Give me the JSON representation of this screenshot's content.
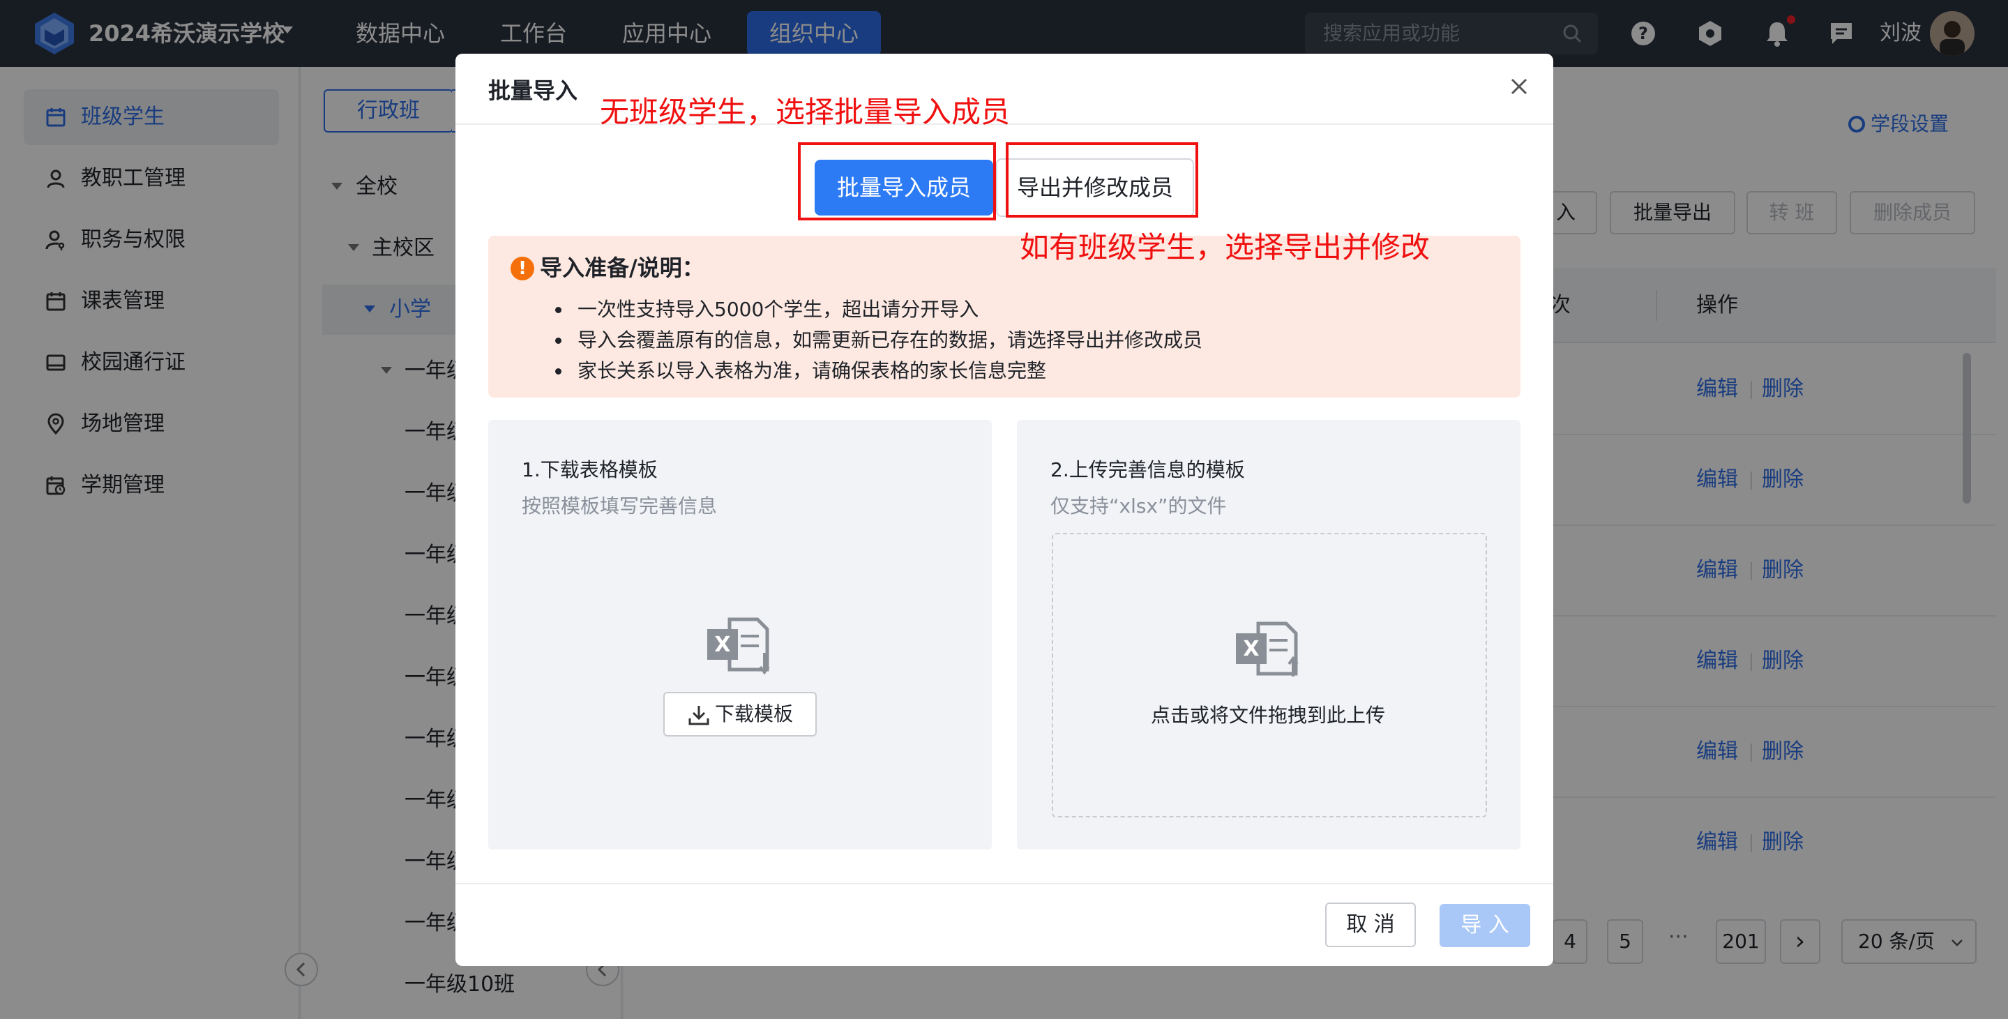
{
  "topbar": {
    "school_name": "2024希沃演示学校",
    "nav": [
      "数据中心",
      "工作台",
      "应用中心",
      "组织中心"
    ],
    "active_nav": "组织中心",
    "search_placeholder": "搜索应用或功能",
    "user_name": "刘波",
    "notification_unread": true
  },
  "sidebar": {
    "items": [
      {
        "label": "班级学生",
        "icon": "calendar-icon",
        "active": true
      },
      {
        "label": "教职工管理",
        "icon": "person-icon"
      },
      {
        "label": "职务与权限",
        "icon": "person-key-icon"
      },
      {
        "label": "课表管理",
        "icon": "calendar-icon"
      },
      {
        "label": "校园通行证",
        "icon": "card-icon"
      },
      {
        "label": "场地管理",
        "icon": "location-pin-icon"
      },
      {
        "label": "学期管理",
        "icon": "calendar-clock-icon"
      }
    ]
  },
  "tree": {
    "tab_label": "行政班",
    "nodes": [
      {
        "label": "全校"
      },
      {
        "label": "主校区"
      },
      {
        "label": "小学",
        "selected": true
      },
      {
        "label": "一年级"
      },
      {
        "label": "一年级"
      },
      {
        "label": "一年级"
      },
      {
        "label": "一年级"
      },
      {
        "label": "一年级"
      },
      {
        "label": "一年级"
      },
      {
        "label": "一年级"
      },
      {
        "label": "一年级"
      },
      {
        "label": "一年级"
      },
      {
        "label": "一年级"
      },
      {
        "label": "一年级10班"
      }
    ]
  },
  "main": {
    "stage_settings": "学段设置",
    "toolbar": {
      "partial_import": "入",
      "batch_export": "批量导出",
      "transfer": "转 班",
      "delete_members": "删除成员"
    },
    "table": {
      "partial_header": "次",
      "op_header": "操作",
      "edit_label": "编辑",
      "delete_label": "删除",
      "rows": 6
    },
    "pagination": {
      "pages": [
        "4",
        "5"
      ],
      "ellipsis": "···",
      "last_page": "201",
      "next": "›",
      "page_size": "20 条/页"
    }
  },
  "modal": {
    "title": "批量导入",
    "seg_primary": "批量导入成员",
    "seg_secondary": "导出并修改成员",
    "notice_title": "导入准备/说明：",
    "notice_items": [
      "一次性支持导入5000个学生，超出请分开导入",
      "导入会覆盖原有的信息，如需更新已存在的数据，请选择导出并修改成员",
      "家长关系以导入表格为准，请确保表格的家长信息完整"
    ],
    "step1_title": "1.下载表格模板",
    "step1_sub": "按照模板填写完善信息",
    "download_label": "下载模板",
    "step2_title": "2.上传完善信息的模板",
    "step2_sub": "仅支持“xlsx”的文件",
    "drop_text": "点击或将文件拖拽到此上传",
    "cancel": "取 消",
    "import": "导 入"
  },
  "annotations": {
    "top": "无班级学生，选择批量导入成员",
    "right": "如有班级学生，选择导出并修改",
    "color": "#f01010"
  },
  "colors": {
    "accent": "#2d6de8",
    "topbar_bg": "#2b323e",
    "notice_bg": "#fde9e1",
    "warning": "#f5700a"
  }
}
